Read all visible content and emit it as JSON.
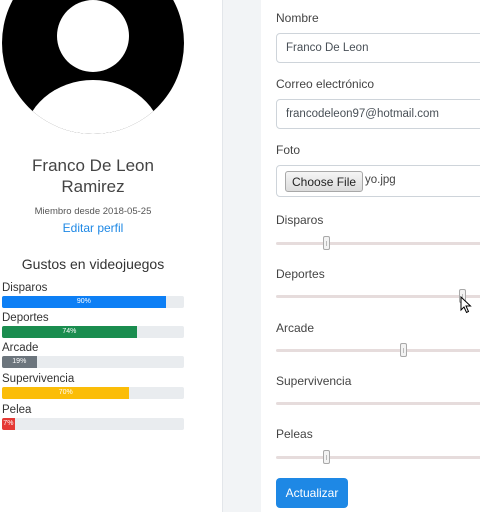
{
  "profile": {
    "name_line1": "Franco De Leon",
    "name_line2": "Ramirez",
    "member_since": "Miembro desde 2018-05-25",
    "edit_link": "Editar perfil"
  },
  "games": {
    "title": "Gustos en videojuegos",
    "items": [
      {
        "label": "Disparos",
        "value_text": "90%",
        "value": 0.9,
        "color": "#0d7ff5"
      },
      {
        "label": "Deportes",
        "value_text": "74%",
        "value": 0.74,
        "color": "#1a8d4f"
      },
      {
        "label": "Arcade",
        "value_text": "19%",
        "value": 0.19,
        "color": "#6c757d"
      },
      {
        "label": "Supervivencia",
        "value_text": "70%",
        "value": 0.7,
        "color": "#fbbd08"
      },
      {
        "label": "Pelea",
        "value_text": "7%",
        "value": 0.07,
        "color": "#e53935"
      }
    ]
  },
  "form": {
    "name_label": "Nombre",
    "name_value": "Franco De Leon",
    "email_label": "Correo electrónico",
    "email_value": "francodeleon97@hotmail.com",
    "photo_label": "Foto",
    "file_button": "Choose File",
    "file_name": "yo.jpg",
    "sliders": [
      {
        "label": "Disparos",
        "value": 0.23
      },
      {
        "label": "Deportes",
        "value": 0.85
      },
      {
        "label": "Arcade",
        "value": 0.58
      },
      {
        "label": "Supervivencia",
        "value": null
      },
      {
        "label": "Peleas",
        "value": 0.23
      }
    ],
    "submit": "Actualizar"
  }
}
